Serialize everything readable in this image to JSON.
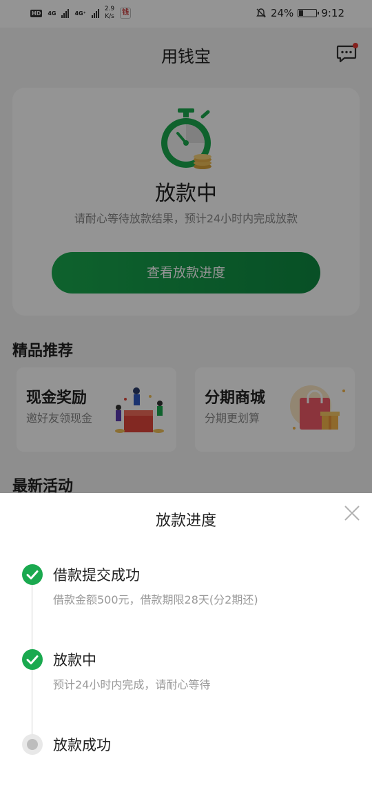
{
  "status_bar": {
    "hd": "HD",
    "signal1": "4G",
    "signal2": "4G⁺",
    "speed_value": "2.9",
    "speed_unit": "K/s",
    "app_icon": "钱",
    "battery": "24%",
    "time": "9:12",
    "battery_level": 0.24
  },
  "header": {
    "title": "用钱宝",
    "message_icon": "chat-bubble-icon"
  },
  "status_card": {
    "title": "放款中",
    "subtitle": "请耐心等待放款结果，预计24小时内完成放款",
    "button_label": "查看放款进度",
    "icon": "stopwatch-icon"
  },
  "recommend": {
    "section_title": "精品推荐",
    "items": [
      {
        "title": "现金奖励",
        "subtitle": "邀好友领现金",
        "icon": "celebration-illustration"
      },
      {
        "title": "分期商城",
        "subtitle": "分期更划算",
        "icon": "shopping-bag-illustration"
      }
    ]
  },
  "activities": {
    "section_title": "最新活动"
  },
  "sheet": {
    "title": "放款进度",
    "close_icon": "close-icon",
    "steps": [
      {
        "title": "借款提交成功",
        "desc": "借款金额500元，借款期限28天(分2期还)",
        "state": "done"
      },
      {
        "title": "放款中",
        "desc": "预计24小时内完成，请耐心等待",
        "state": "done"
      },
      {
        "title": "放款成功",
        "desc": "",
        "state": "pending"
      }
    ]
  },
  "colors": {
    "accent": "#1aa94f",
    "accent_dark": "#0e8a42",
    "badge": "#e53935"
  }
}
